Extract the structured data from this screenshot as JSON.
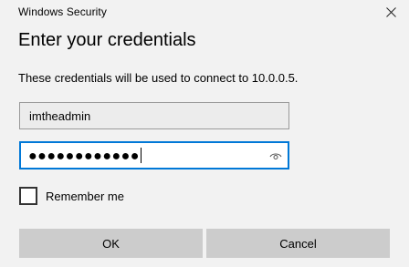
{
  "window": {
    "app_title": "Windows Security",
    "close_icon": "close-icon"
  },
  "dialog": {
    "heading": "Enter your credentials",
    "description": "These credentials will be used to connect to 10.0.0.5."
  },
  "username": {
    "value": "imtheadmin"
  },
  "password": {
    "masked_value": "●●●●●●●●●●●●",
    "reveal_icon": "eye-icon"
  },
  "remember": {
    "label": "Remember me",
    "checked": false
  },
  "buttons": {
    "ok_label": "OK",
    "cancel_label": "Cancel"
  },
  "colors": {
    "background": "#f2f2f2",
    "focus_border": "#0078d7",
    "button_bg": "#cccccc"
  }
}
